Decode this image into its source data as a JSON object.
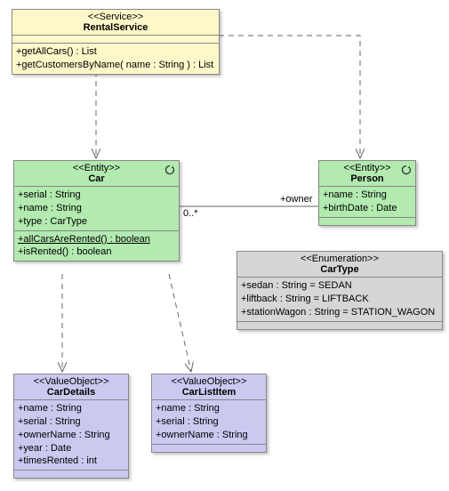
{
  "service": {
    "stereo": "<<Service>>",
    "title": "RentalService",
    "ops": {
      "getAllCars": "+getAllCars() : List",
      "getCustomersByName": "+getCustomersByName( name : String ) : List"
    }
  },
  "car": {
    "stereo": "<<Entity>>",
    "title": "Car",
    "attrs": {
      "serial": "+serial : String",
      "name": "+name : String",
      "type": "+type : CarType"
    },
    "ops": {
      "allRented": "+allCarsAreRented() : boolean",
      "isRented": "+isRented() : boolean"
    }
  },
  "person": {
    "stereo": "<<Entity>>",
    "title": "Person",
    "attrs": {
      "name": "+name : String",
      "birthDate": "+birthDate : Date"
    }
  },
  "carType": {
    "stereo": "<<Enumeration>>",
    "title": "CarType",
    "attrs": {
      "sedan": "+sedan : String = SEDAN",
      "liftback": "+liftback : String = LIFTBACK",
      "wagon": "+stationWagon : String = STATION_WAGON"
    }
  },
  "carDetails": {
    "stereo": "<<ValueObject>>",
    "title": "CarDetails",
    "attrs": {
      "name": "+name : String",
      "serial": "+serial : String",
      "ownerName": "+ownerName : String",
      "year": "+year : Date",
      "timesRented": "+timesRented : int"
    }
  },
  "carListItem": {
    "stereo": "<<ValueObject>>",
    "title": "CarListItem",
    "attrs": {
      "name": "+name : String",
      "serial": "+serial : String",
      "ownerName": "+ownerName : String"
    }
  },
  "assoc": {
    "mult": "0..*",
    "owner": "+owner"
  }
}
